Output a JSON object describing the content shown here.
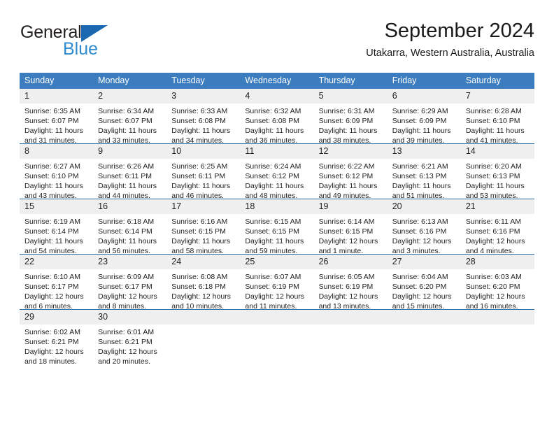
{
  "logo": {
    "word_one": "General",
    "word_two": "Blue",
    "triangle_color": "#1b68b0",
    "blue_text_color": "#2e8bd0"
  },
  "header": {
    "title": "September 2024",
    "subtitle": "Utakarra, Western Australia, Australia"
  },
  "theme": {
    "header_bg": "#3b7dbf",
    "row_divider": "#2e6da4",
    "daynum_bg": "#efefef",
    "text": "#222222"
  },
  "weekdays": [
    "Sunday",
    "Monday",
    "Tuesday",
    "Wednesday",
    "Thursday",
    "Friday",
    "Saturday"
  ],
  "labels": {
    "sunrise_prefix": "Sunrise:",
    "sunset_prefix": "Sunset:",
    "daylight_prefix": "Daylight:"
  },
  "weeks": [
    [
      {
        "day": "1",
        "sunrise": "Sunrise: 6:35 AM",
        "sunset": "Sunset: 6:07 PM",
        "daylight": "Daylight: 11 hours and 31 minutes."
      },
      {
        "day": "2",
        "sunrise": "Sunrise: 6:34 AM",
        "sunset": "Sunset: 6:07 PM",
        "daylight": "Daylight: 11 hours and 33 minutes."
      },
      {
        "day": "3",
        "sunrise": "Sunrise: 6:33 AM",
        "sunset": "Sunset: 6:08 PM",
        "daylight": "Daylight: 11 hours and 34 minutes."
      },
      {
        "day": "4",
        "sunrise": "Sunrise: 6:32 AM",
        "sunset": "Sunset: 6:08 PM",
        "daylight": "Daylight: 11 hours and 36 minutes."
      },
      {
        "day": "5",
        "sunrise": "Sunrise: 6:31 AM",
        "sunset": "Sunset: 6:09 PM",
        "daylight": "Daylight: 11 hours and 38 minutes."
      },
      {
        "day": "6",
        "sunrise": "Sunrise: 6:29 AM",
        "sunset": "Sunset: 6:09 PM",
        "daylight": "Daylight: 11 hours and 39 minutes."
      },
      {
        "day": "7",
        "sunrise": "Sunrise: 6:28 AM",
        "sunset": "Sunset: 6:10 PM",
        "daylight": "Daylight: 11 hours and 41 minutes."
      }
    ],
    [
      {
        "day": "8",
        "sunrise": "Sunrise: 6:27 AM",
        "sunset": "Sunset: 6:10 PM",
        "daylight": "Daylight: 11 hours and 43 minutes."
      },
      {
        "day": "9",
        "sunrise": "Sunrise: 6:26 AM",
        "sunset": "Sunset: 6:11 PM",
        "daylight": "Daylight: 11 hours and 44 minutes."
      },
      {
        "day": "10",
        "sunrise": "Sunrise: 6:25 AM",
        "sunset": "Sunset: 6:11 PM",
        "daylight": "Daylight: 11 hours and 46 minutes."
      },
      {
        "day": "11",
        "sunrise": "Sunrise: 6:24 AM",
        "sunset": "Sunset: 6:12 PM",
        "daylight": "Daylight: 11 hours and 48 minutes."
      },
      {
        "day": "12",
        "sunrise": "Sunrise: 6:22 AM",
        "sunset": "Sunset: 6:12 PM",
        "daylight": "Daylight: 11 hours and 49 minutes."
      },
      {
        "day": "13",
        "sunrise": "Sunrise: 6:21 AM",
        "sunset": "Sunset: 6:13 PM",
        "daylight": "Daylight: 11 hours and 51 minutes."
      },
      {
        "day": "14",
        "sunrise": "Sunrise: 6:20 AM",
        "sunset": "Sunset: 6:13 PM",
        "daylight": "Daylight: 11 hours and 53 minutes."
      }
    ],
    [
      {
        "day": "15",
        "sunrise": "Sunrise: 6:19 AM",
        "sunset": "Sunset: 6:14 PM",
        "daylight": "Daylight: 11 hours and 54 minutes."
      },
      {
        "day": "16",
        "sunrise": "Sunrise: 6:18 AM",
        "sunset": "Sunset: 6:14 PM",
        "daylight": "Daylight: 11 hours and 56 minutes."
      },
      {
        "day": "17",
        "sunrise": "Sunrise: 6:16 AM",
        "sunset": "Sunset: 6:15 PM",
        "daylight": "Daylight: 11 hours and 58 minutes."
      },
      {
        "day": "18",
        "sunrise": "Sunrise: 6:15 AM",
        "sunset": "Sunset: 6:15 PM",
        "daylight": "Daylight: 11 hours and 59 minutes."
      },
      {
        "day": "19",
        "sunrise": "Sunrise: 6:14 AM",
        "sunset": "Sunset: 6:15 PM",
        "daylight": "Daylight: 12 hours and 1 minute."
      },
      {
        "day": "20",
        "sunrise": "Sunrise: 6:13 AM",
        "sunset": "Sunset: 6:16 PM",
        "daylight": "Daylight: 12 hours and 3 minutes."
      },
      {
        "day": "21",
        "sunrise": "Sunrise: 6:11 AM",
        "sunset": "Sunset: 6:16 PM",
        "daylight": "Daylight: 12 hours and 4 minutes."
      }
    ],
    [
      {
        "day": "22",
        "sunrise": "Sunrise: 6:10 AM",
        "sunset": "Sunset: 6:17 PM",
        "daylight": "Daylight: 12 hours and 6 minutes."
      },
      {
        "day": "23",
        "sunrise": "Sunrise: 6:09 AM",
        "sunset": "Sunset: 6:17 PM",
        "daylight": "Daylight: 12 hours and 8 minutes."
      },
      {
        "day": "24",
        "sunrise": "Sunrise: 6:08 AM",
        "sunset": "Sunset: 6:18 PM",
        "daylight": "Daylight: 12 hours and 10 minutes."
      },
      {
        "day": "25",
        "sunrise": "Sunrise: 6:07 AM",
        "sunset": "Sunset: 6:19 PM",
        "daylight": "Daylight: 12 hours and 11 minutes."
      },
      {
        "day": "26",
        "sunrise": "Sunrise: 6:05 AM",
        "sunset": "Sunset: 6:19 PM",
        "daylight": "Daylight: 12 hours and 13 minutes."
      },
      {
        "day": "27",
        "sunrise": "Sunrise: 6:04 AM",
        "sunset": "Sunset: 6:20 PM",
        "daylight": "Daylight: 12 hours and 15 minutes."
      },
      {
        "day": "28",
        "sunrise": "Sunrise: 6:03 AM",
        "sunset": "Sunset: 6:20 PM",
        "daylight": "Daylight: 12 hours and 16 minutes."
      }
    ],
    [
      {
        "day": "29",
        "sunrise": "Sunrise: 6:02 AM",
        "sunset": "Sunset: 6:21 PM",
        "daylight": "Daylight: 12 hours and 18 minutes."
      },
      {
        "day": "30",
        "sunrise": "Sunrise: 6:01 AM",
        "sunset": "Sunset: 6:21 PM",
        "daylight": "Daylight: 12 hours and 20 minutes."
      },
      {
        "day": "",
        "sunrise": "",
        "sunset": "",
        "daylight": ""
      },
      {
        "day": "",
        "sunrise": "",
        "sunset": "",
        "daylight": ""
      },
      {
        "day": "",
        "sunrise": "",
        "sunset": "",
        "daylight": ""
      },
      {
        "day": "",
        "sunrise": "",
        "sunset": "",
        "daylight": ""
      },
      {
        "day": "",
        "sunrise": "",
        "sunset": "",
        "daylight": ""
      }
    ]
  ]
}
